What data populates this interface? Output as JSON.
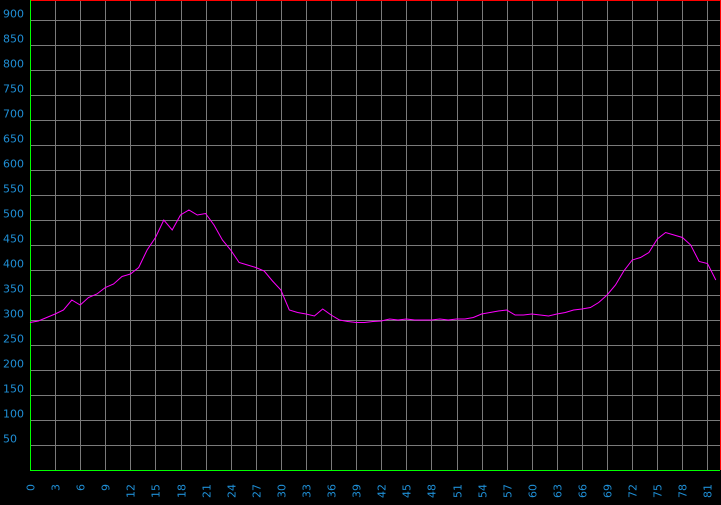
{
  "chart_data": {
    "type": "line",
    "x_ticks": [
      "0",
      "3",
      "6",
      "9",
      "12",
      "15",
      "18",
      "21",
      "24",
      "27",
      "30",
      "33",
      "36",
      "39",
      "42",
      "45",
      "48",
      "51",
      "54",
      "57",
      "60",
      "63",
      "66",
      "69",
      "72",
      "75",
      "78",
      "81"
    ],
    "y_ticks": [
      "50",
      "100",
      "150",
      "200",
      "250",
      "300",
      "350",
      "400",
      "450",
      "500",
      "550",
      "600",
      "650",
      "700",
      "750",
      "800",
      "850",
      "900"
    ],
    "xlim": [
      0,
      82.5
    ],
    "ylim": [
      0,
      940
    ],
    "grid": true,
    "colors": {
      "background": "#000000",
      "grid": "#7a7a7a",
      "series": "#ff00ff",
      "tick_labels": "#1f8fd6",
      "top_border": "#ff0000",
      "left_bottom_axes": "#00ff00"
    },
    "series": [
      {
        "x": [
          0,
          1,
          2,
          3,
          4,
          5,
          6,
          7,
          8,
          9,
          10,
          11,
          12,
          13,
          14,
          15,
          16,
          17,
          18,
          19,
          20,
          21,
          22,
          23,
          24,
          25,
          26,
          27,
          28,
          29,
          30,
          31,
          32,
          33,
          34,
          35,
          36,
          37,
          38,
          39,
          40,
          41,
          42,
          43,
          44,
          45,
          46,
          47,
          48,
          49,
          50,
          51,
          52,
          53,
          54,
          55,
          56,
          57,
          58,
          59,
          60,
          61,
          62,
          63,
          64,
          65,
          66,
          67,
          68,
          69,
          70,
          71,
          72,
          73,
          74,
          75,
          76,
          77,
          78,
          79,
          80,
          81,
          82
        ],
        "y": [
          295,
          298,
          305,
          312,
          320,
          340,
          330,
          345,
          352,
          365,
          372,
          387,
          392,
          405,
          440,
          465,
          500,
          480,
          510,
          520,
          510,
          513,
          490,
          460,
          440,
          415,
          410,
          405,
          398,
          378,
          360,
          320,
          315,
          312,
          308,
          322,
          310,
          300,
          297,
          295,
          295,
          297,
          298,
          302,
          300,
          302,
          300,
          300,
          300,
          302,
          300,
          302,
          302,
          305,
          312,
          315,
          318,
          320,
          310,
          310,
          312,
          310,
          308,
          312,
          315,
          320,
          322,
          325,
          335,
          350,
          370,
          398,
          420,
          425,
          435,
          462,
          475,
          470,
          465,
          450,
          417,
          413,
          380
        ]
      }
    ]
  }
}
